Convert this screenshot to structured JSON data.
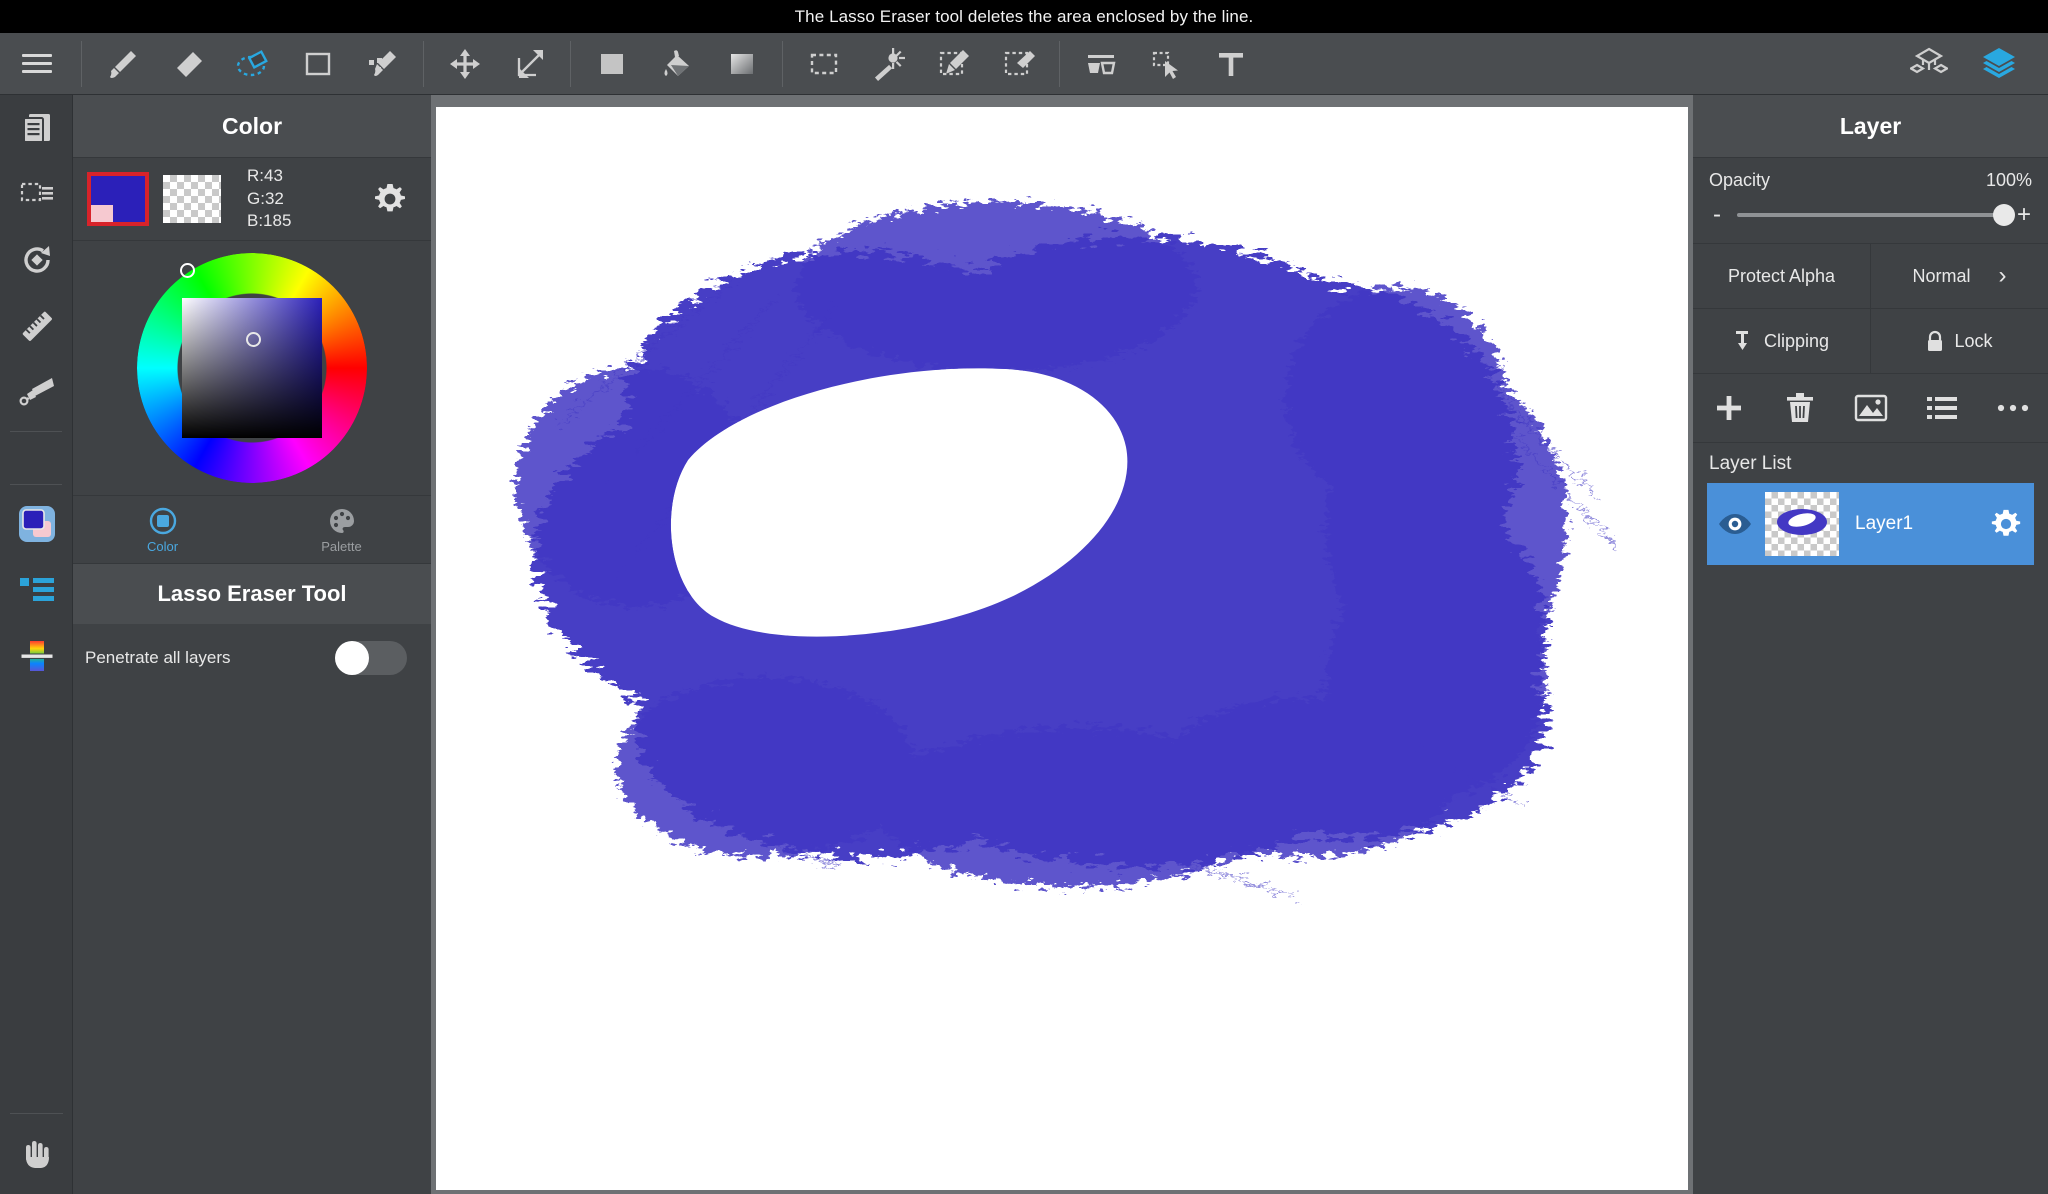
{
  "hint": {
    "text": "The Lasso Eraser tool deletes the area enclosed by the line."
  },
  "toolbar": {
    "menu_label": "menu",
    "tools": [
      {
        "name": "brush-tool",
        "label": "Brush",
        "active": false
      },
      {
        "name": "eraser-tool",
        "label": "Eraser",
        "active": false
      },
      {
        "name": "lasso-eraser-tool",
        "label": "Lasso Eraser",
        "active": true
      },
      {
        "name": "rectangle-tool",
        "label": "Rectangle",
        "active": false
      },
      {
        "name": "polyline-tool",
        "label": "Polyline",
        "active": false
      },
      {
        "name": "move-tool",
        "label": "Move",
        "active": false
      },
      {
        "name": "transform-tool",
        "label": "Transform",
        "active": false
      },
      {
        "name": "fill-tool",
        "label": "Fill",
        "active": false
      },
      {
        "name": "bucket-tool",
        "label": "Bucket",
        "active": false
      },
      {
        "name": "gradient-tool",
        "label": "Gradient",
        "active": false
      },
      {
        "name": "marquee-select-tool",
        "label": "Select",
        "active": false
      },
      {
        "name": "magic-wand-tool",
        "label": "Magic Wand",
        "active": false
      },
      {
        "name": "select-pen-tool",
        "label": "Select Pen",
        "active": false
      },
      {
        "name": "select-eraser-tool",
        "label": "Select Eraser",
        "active": false
      },
      {
        "name": "split-view-tool",
        "label": "Split",
        "active": false
      },
      {
        "name": "operation-tool",
        "label": "Operation",
        "active": false
      },
      {
        "name": "text-tool",
        "label": "Text",
        "active": false
      }
    ],
    "right_tools": [
      {
        "name": "material-icon",
        "label": "Material"
      },
      {
        "name": "layer-panel-icon",
        "label": "Layer"
      }
    ],
    "accent": "#29a8e0"
  },
  "rail": {
    "items": [
      {
        "name": "file-icon",
        "label": "File"
      },
      {
        "name": "selection-icon",
        "label": "Selection"
      },
      {
        "name": "rotate-icon",
        "label": "Rotate"
      },
      {
        "name": "ruler-icon",
        "label": "Ruler"
      },
      {
        "name": "airbrush-icon",
        "label": "Airbrush"
      },
      {
        "name": "color-swatch-icon",
        "label": "Color"
      },
      {
        "name": "brush-settings-icon",
        "label": "Brush Settings"
      },
      {
        "name": "palette-bar-icon",
        "label": "Palette"
      },
      {
        "name": "hand-icon",
        "label": "Hand"
      }
    ]
  },
  "color_panel": {
    "title": "Color",
    "foreground_hex": "#2b20b9",
    "corner_hex": "#f6c9d0",
    "selection_border": "#d8232a",
    "rgb": {
      "r": "R:43",
      "g": "G:32",
      "b": "B:185"
    },
    "gear_label": "Color settings",
    "tabs": [
      {
        "label": "Color",
        "active": true
      },
      {
        "label": "Palette",
        "active": false
      }
    ]
  },
  "tool_options": {
    "title": "Lasso Eraser Tool",
    "penetrate_label": "Penetrate all layers",
    "penetrate_on": false
  },
  "layer_panel": {
    "title": "Layer",
    "opacity_label": "Opacity",
    "opacity_value": "100%",
    "minus": "-",
    "plus": "+",
    "protect_alpha": "Protect Alpha",
    "blend_mode": "Normal",
    "blend_chevron": "›",
    "clipping": "Clipping",
    "lock": "Lock",
    "actions": [
      {
        "name": "add-layer-button",
        "label": "Add"
      },
      {
        "name": "delete-layer-button",
        "label": "Delete"
      },
      {
        "name": "duplicate-layer-button",
        "label": "Duplicate"
      },
      {
        "name": "layer-options-button",
        "label": "Options"
      },
      {
        "name": "more-options-button",
        "label": "More"
      }
    ],
    "list_label": "Layer List",
    "layers": [
      {
        "name": "Layer1",
        "visible": true,
        "selected": true
      }
    ],
    "selected_color": "#4a90d9"
  },
  "canvas": {
    "background": "#ffffff",
    "surround": "#6e7174",
    "stroke_color": "#4338c4",
    "erased_shape": "lasso-erased-oval"
  }
}
